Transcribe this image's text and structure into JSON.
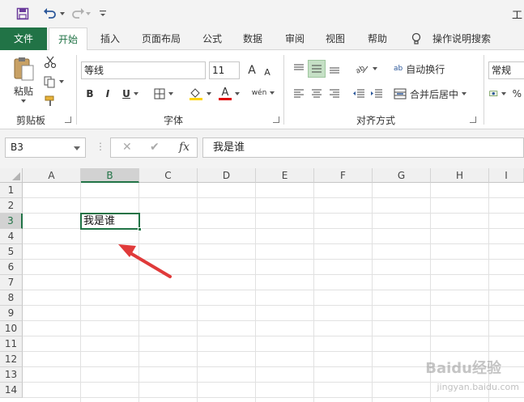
{
  "title_fragment": "工",
  "tabs": [
    {
      "label": "文件"
    },
    {
      "label": "开始"
    },
    {
      "label": "插入"
    },
    {
      "label": "页面布局"
    },
    {
      "label": "公式"
    },
    {
      "label": "数据"
    },
    {
      "label": "审阅"
    },
    {
      "label": "视图"
    },
    {
      "label": "帮助"
    }
  ],
  "tell_me": "操作说明搜索",
  "clipboard": {
    "paste_label": "粘贴",
    "group_label": "剪贴板"
  },
  "font": {
    "name": "等线",
    "size": "11",
    "grow": "A",
    "shrink": "A",
    "bold": "B",
    "italic": "I",
    "underline": "U",
    "font_color_glyph": "A",
    "phonetic_glyph": "wén",
    "group_label": "字体"
  },
  "alignment": {
    "wrap_text": "自动换行",
    "merge_center": "合并后居中",
    "group_label": "对齐方式",
    "wrap_glyph": "ab"
  },
  "number": {
    "format": "常规"
  },
  "formula_bar": {
    "name_box": "B3",
    "cancel": "✕",
    "enter": "✔",
    "fx": "fx",
    "value": "我是谁"
  },
  "sheet": {
    "columns": [
      "A",
      "B",
      "C",
      "D",
      "E",
      "F",
      "G",
      "H",
      "I"
    ],
    "rows": [
      "1",
      "2",
      "3",
      "4",
      "5",
      "6",
      "7",
      "8",
      "9",
      "10",
      "11",
      "12",
      "13",
      "14"
    ],
    "selected_column": "B",
    "selected_row": "3",
    "active_cell_value": "我是谁"
  },
  "watermark": {
    "brand": "Baidu经验",
    "sub": "jingyan.baidu.com"
  },
  "colors": {
    "accent": "#217346",
    "arrow": "#e03a3a",
    "highlight": "#ffd400",
    "font_red": "#e00000"
  }
}
